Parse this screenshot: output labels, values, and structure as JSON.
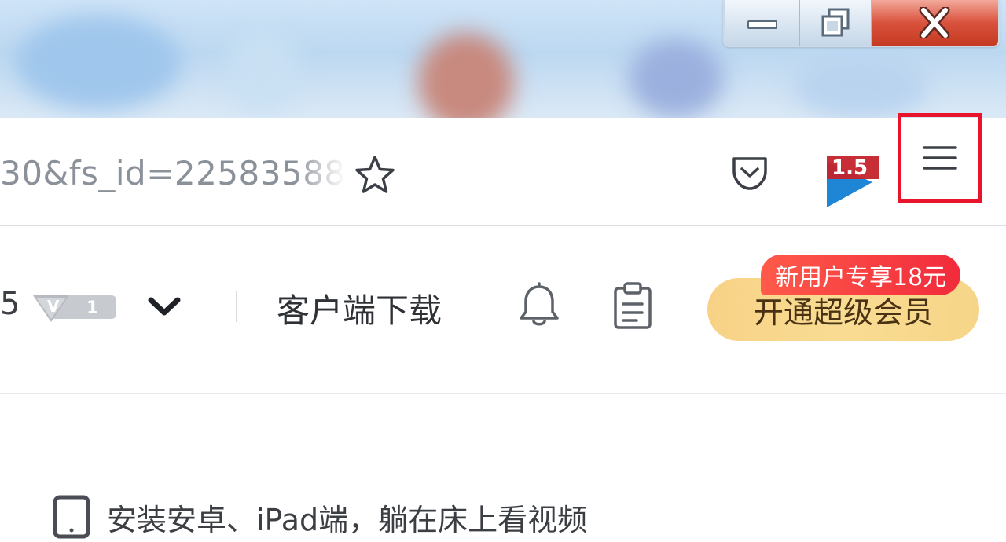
{
  "window_controls": {
    "minimize_icon": "minimize-icon",
    "restore_icon": "restore-icon",
    "close_icon": "close-icon"
  },
  "address_bar": {
    "url_fragment": "30&fs_id=22583588",
    "bookmark_icon": "star-icon",
    "pocket_icon": "pocket-icon",
    "extension_badge_text": "1.5",
    "menu_icon": "hamburger-menu-icon",
    "highlight_color": "#e8142b"
  },
  "site_header": {
    "user_fragment": "5",
    "vip_level": "1",
    "download_link": "客户端下载",
    "notification_icon": "bell-icon",
    "tasks_icon": "clipboard-icon",
    "upgrade_button": "开通超级会员",
    "promo_badge": "新用户专享18元"
  },
  "promo_line": {
    "icon": "tablet-icon",
    "text": "安装安卓、iPad端，躺在床上看视频"
  }
}
